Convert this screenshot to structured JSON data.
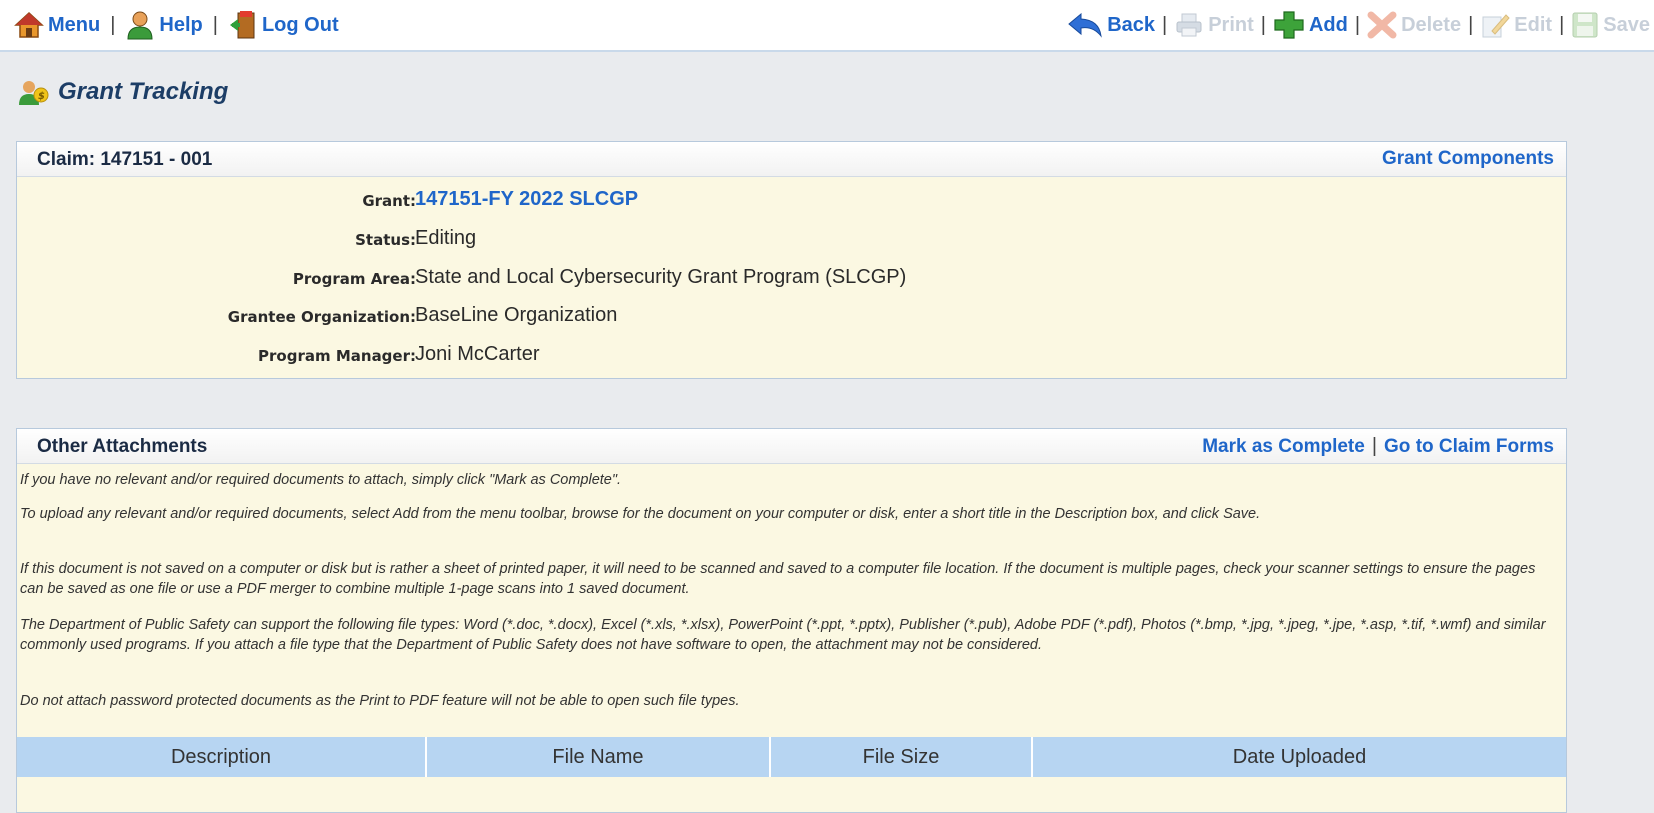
{
  "toolbar": {
    "left": [
      {
        "label": "Menu",
        "icon": "home-icon"
      },
      {
        "label": "Help",
        "icon": "user-help-icon"
      },
      {
        "label": "Log Out",
        "icon": "exit-door-icon"
      }
    ],
    "right": {
      "back": "Back",
      "print": "Print",
      "add": "Add",
      "delete": "Delete",
      "edit": "Edit",
      "save": "Save"
    },
    "separator": "|"
  },
  "page": {
    "title": "Grant Tracking"
  },
  "claim_panel": {
    "title": "Claim: 147151 - 001",
    "link": "Grant Components",
    "fields": {
      "grant_label": "Grant:",
      "grant_value": "147151-FY 2022 SLCGP",
      "status_label": "Status:",
      "status_value": "Editing",
      "program_area_label": "Program Area:",
      "program_area_value": "State and Local Cybersecurity Grant Program (SLCGP)",
      "grantee_label": "Grantee Organization:",
      "grantee_value": "BaseLine Organization",
      "manager_label": "Program Manager:",
      "manager_value": "Joni McCarter"
    }
  },
  "attachments_panel": {
    "title": "Other Attachments",
    "mark_complete": "Mark as Complete",
    "go_to_forms": "Go to Claim Forms",
    "instructions": {
      "p1": "If you have no relevant and/or required documents to attach, simply click \"Mark as Complete\".",
      "p2": "To upload any relevant and/or required documents, select Add from the menu toolbar, browse for the document on your computer or disk, enter a short title in the Description box, and click Save.",
      "p3": "If this document is not saved on a computer or disk but is rather a sheet of printed paper, it will need to be scanned and saved to a computer file location. If the document is multiple pages, check your scanner settings to ensure the pages can be saved as one file or use a PDF merger to combine multiple 1-page scans into 1 saved document.",
      "p4": "The Department of Public Safety can support the following file types: Word (*.doc, *.docx), Excel (*.xls, *.xlsx), PowerPoint (*.ppt, *.pptx), Publisher (*.pub), Adobe PDF (*.pdf), Photos (*.bmp, *.jpg, *.jpeg, *.jpe, *.asp, *.tif, *.wmf) and similar commonly used programs. If you attach a file type that the Department of Public Safety does not have software to open, the attachment may not be considered.",
      "p5": "Do not attach password protected documents as the Print to PDF feature will not be able to open such file types."
    },
    "columns": [
      "Description",
      "File Name",
      "File Size",
      "Date Uploaded"
    ]
  }
}
